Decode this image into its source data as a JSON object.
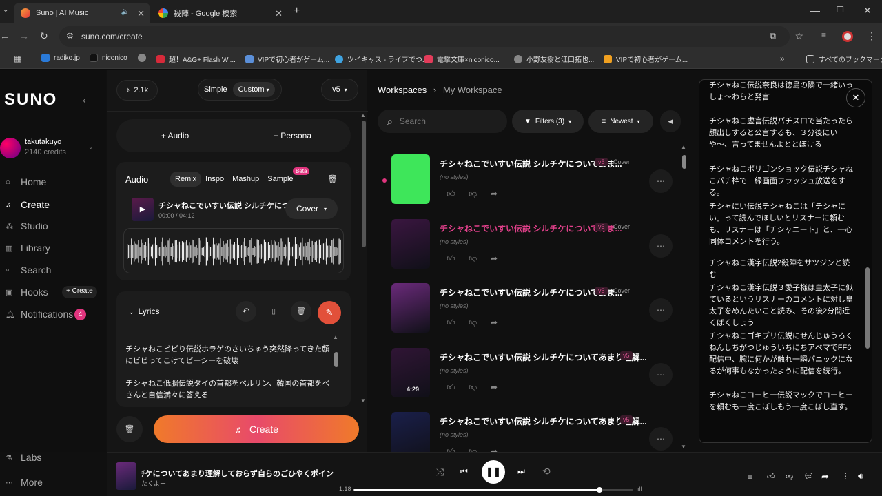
{
  "browser": {
    "tabs": [
      {
        "title": "Suno | AI Music"
      },
      {
        "title": "殺陣 - Google 検索"
      }
    ],
    "url": "suno.com/create",
    "bookmarks": [
      "radiko.jp",
      "niconico",
      "超！A&G+ Flash Wi...",
      "VIPで初心者がゲーム...",
      "ツイキャス - ライブでつ...",
      "電撃文庫×niconico...",
      "小野友樹と江口拓也...",
      "VIPで初心者がゲーム..."
    ],
    "all_bookmarks": "すべてのブックマーク",
    "icons": [
      "back-arrow-icon",
      "forward-arrow-icon",
      "reload-icon",
      "site-settings-icon",
      "install-icon",
      "star-icon",
      "media-icon",
      "profile-icon",
      "menu-icon",
      "apps-icon",
      "chevron-icon",
      "folder-icon"
    ]
  },
  "sidebar": {
    "logo": "SUNO",
    "user": {
      "name": "takutakuyo",
      "credits": "2140 credits"
    },
    "nav": [
      {
        "label": "Home",
        "icon": "home-icon"
      },
      {
        "label": "Create",
        "icon": "music-note-icon"
      },
      {
        "label": "Studio",
        "icon": "studio-icon"
      },
      {
        "label": "Library",
        "icon": "library-icon"
      },
      {
        "label": "Search",
        "icon": "search-icon"
      },
      {
        "label": "Hooks",
        "icon": "hooks-icon"
      },
      {
        "label": "Notifications",
        "icon": "bell-icon"
      }
    ],
    "hooks_create": "+ Create",
    "notification_count": "4",
    "bottom": [
      {
        "label": "Labs",
        "icon": "flask-icon"
      },
      {
        "label": "More",
        "icon": "dots-icon"
      }
    ]
  },
  "create": {
    "credits_count": "2.1k",
    "mode_simple": "Simple",
    "mode_custom": "Custom",
    "version": "v5",
    "add_audio": "+ Audio",
    "add_persona": "+ Persona",
    "audio_label": "Audio",
    "audio_tabs": [
      "Remix",
      "Inspo",
      "Mashup",
      "Sample"
    ],
    "beta": "Beta",
    "track_title": "チシャねこでいすい伝説 シルチケについて...",
    "track_time": "00:00 / 04:12",
    "cover_btn": "Cover",
    "lyrics_label": "Lyrics",
    "lyrics_preview": [
      "チシャねこビビり伝説ホラゲのさいちゅう突然降ってきた顔にビビってこけてピーシーを破壊",
      "チシャねこ低脳伝説タイの首都をベルリン、韓国の首都をべさんと自信満々に答える"
    ],
    "create_btn": "Create"
  },
  "workspace": {
    "crumb_root": "Workspaces",
    "crumb_current": "My Workspace",
    "search_placeholder": "Search",
    "filters": "Filters (3)",
    "sort": "Newest",
    "songs": [
      {
        "title": "チシャねこでいすい伝説 シルチケについてあま...",
        "style": "(no styles)",
        "version": "v5",
        "cover": "Cover",
        "color": "#3ee65a"
      },
      {
        "title": "チシャねこでいすい伝説 シルチケについてあま...",
        "style": "(no styles)",
        "version": "v5",
        "cover": "Cover",
        "color": "#3a1640"
      },
      {
        "title": "チシャねこでいすい伝説 シルチケについてあま...",
        "style": "(no styles)",
        "version": "v5",
        "cover": "Cover",
        "color": "#6a2a7a"
      },
      {
        "title": "チシャねこでいすい伝説 シルチケについてあまり理解...",
        "style": "(no styles)",
        "version": "v5",
        "cover": "",
        "color": "#301535",
        "duration": "4:29"
      },
      {
        "title": "チシャねこでいすい伝説 シルチケについてあまり理解...",
        "style": "(no styles)",
        "version": "v5",
        "cover": "",
        "color": "#1a1f4a"
      }
    ]
  },
  "lyrics_panel": {
    "paragraphs": [
      "チシャねこ伝説奈良は徳島の隣で一緒いっしょ〜わらと発言",
      "チシャねこ虚言伝説パチスロで当たったら顔出しすると公言するも、３分後にいや〜、言ってませんよととぼける",
      "チシャねこポリゴンショック伝説チシャねこパチ枠で　緑画面フラッシュ放送をする。",
      "チシャにい伝説チシャねこは「チシャにい」って読んでほしいとリスナーに頼むも、リスナーは「チシャニート」と、一心同体コメントを行う。",
      "チシャねこ漢字伝説2殺陣をサツジンと読む",
      "チシャねこ漢字伝説３愛子様は皇太子に似ているというリスナーのコメントに対し皇太子をめんたいこと読み、その後2分間近くばくしょう",
      "チシャねこゴキブリ伝説にせんじゅうろくねんしちがつじゅういちにちアベマでFF6配信中、腕に何かが触れ一瞬パニックになるが何事もなかったように配信を続行。",
      "チシャねこコーヒー伝説マックでコーヒーを頼むも一度こぼしもう一度こぼし直す。"
    ]
  },
  "player": {
    "title": "ﾁケについてあまり理解しておらず自らのごひやくポイン",
    "artist": "たくよー",
    "time": "1:18",
    "progress": 0.88
  }
}
